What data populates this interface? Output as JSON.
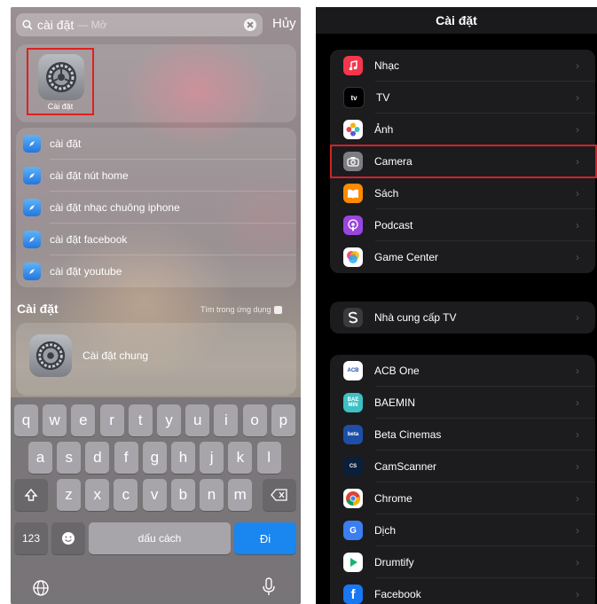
{
  "left": {
    "search": {
      "query": "cài đặt",
      "hint": "— Mở",
      "cancel": "Hủy"
    },
    "top_hit": {
      "app_label": "Cài đặt"
    },
    "suggestions": [
      {
        "text": "cài đặt"
      },
      {
        "text": "cài đặt nút home"
      },
      {
        "text": "cài đặt nhạc chuông iphone"
      },
      {
        "text": "cài đặt facebook"
      },
      {
        "text": "cài đặt youtube"
      }
    ],
    "section": {
      "title": "Cài đặt",
      "link": "Tìm trong ứng dụng"
    },
    "result": {
      "label": "Cài đặt chung"
    },
    "keyboard": {
      "row1": [
        "q",
        "w",
        "e",
        "r",
        "t",
        "y",
        "u",
        "i",
        "o",
        "p"
      ],
      "row2": [
        "a",
        "s",
        "d",
        "f",
        "g",
        "h",
        "j",
        "k",
        "l"
      ],
      "row3": [
        "z",
        "x",
        "c",
        "v",
        "b",
        "n",
        "m"
      ],
      "numbers": "123",
      "space": "dấu cách",
      "go": "Đi"
    }
  },
  "right": {
    "title": "Cài đặt",
    "groups": [
      [
        {
          "label": "Nhạc",
          "icon": "music-icon",
          "color": "#f4364c"
        },
        {
          "label": "TV",
          "icon": "apple-tv-icon",
          "color": "#000000"
        },
        {
          "label": "Ảnh",
          "icon": "photos-icon",
          "color": "#ffffff"
        },
        {
          "label": "Camera",
          "icon": "camera-icon",
          "color": "#7d7d82"
        },
        {
          "label": "Sách",
          "icon": "books-icon",
          "color": "#ff8a00"
        },
        {
          "label": "Podcast",
          "icon": "podcast-icon",
          "color": "#9b45e0"
        },
        {
          "label": "Game Center",
          "icon": "game-center-icon",
          "color": "#ffffff"
        }
      ],
      [
        {
          "label": "Nhà cung cấp TV",
          "icon": "tv-provider-icon",
          "color": "#3a3a3c"
        }
      ],
      [
        {
          "label": "ACB One",
          "icon": "acb-one-icon",
          "color": "#ffffff",
          "badge": "ACB"
        },
        {
          "label": "BAEMIN",
          "icon": "baemin-icon",
          "color": "#3cc1c5",
          "badge": "BAE\nMIN"
        },
        {
          "label": "Beta Cinemas",
          "icon": "beta-cinemas-icon",
          "color": "#1d4fa8",
          "badge": "beta"
        },
        {
          "label": "CamScanner",
          "icon": "camscanner-icon",
          "color": "#0b1e3a",
          "badge": "CS"
        },
        {
          "label": "Chrome",
          "icon": "chrome-icon",
          "color": "#ffffff"
        },
        {
          "label": "Dịch",
          "icon": "translate-icon",
          "color": "#3b7ef0"
        },
        {
          "label": "Drumtify",
          "icon": "drumtify-icon",
          "color": "#ffffff"
        },
        {
          "label": "Facebook",
          "icon": "facebook-icon",
          "color": "#1877f2"
        }
      ]
    ],
    "highlight_color": "#d4202a"
  }
}
